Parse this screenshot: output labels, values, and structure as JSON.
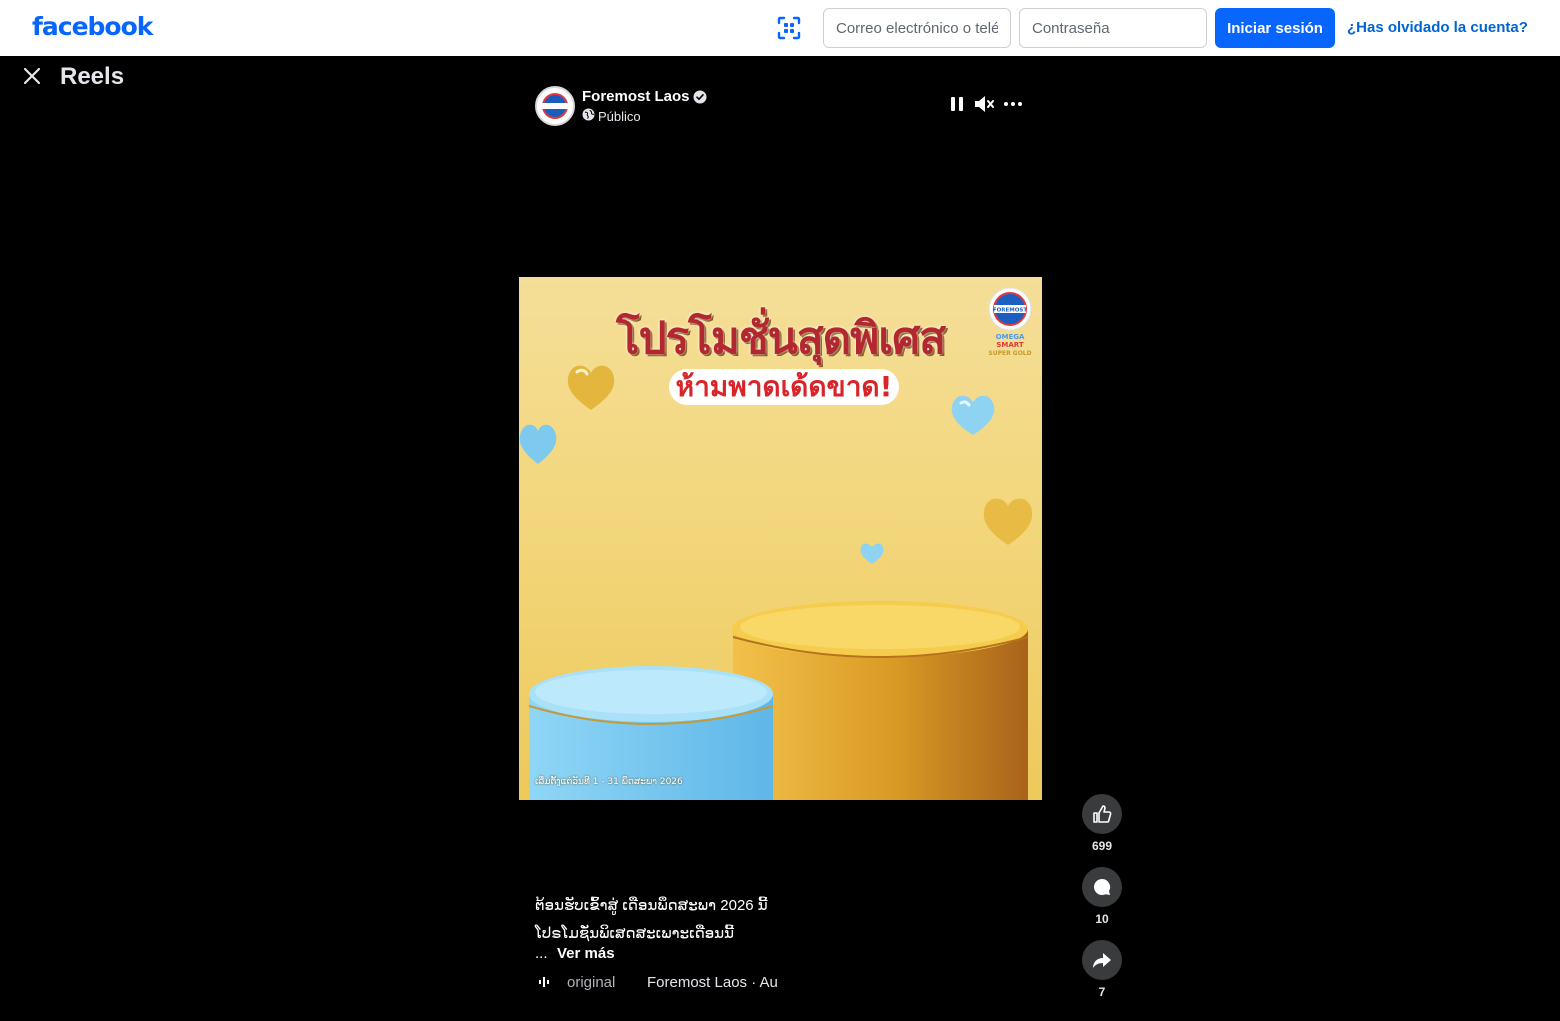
{
  "header": {
    "logo": "facebook",
    "email_placeholder": "Correo electrónico o teléfono",
    "password_placeholder": "Contraseña",
    "login_label": "Iniciar sesión",
    "forgot_label": "¿Has olvidado la cuenta?"
  },
  "reels": {
    "title": "Reels"
  },
  "post": {
    "page_name": "Foremost Laos",
    "privacy": "Público",
    "video": {
      "headline": "โปรโมชั่นสุดพิเศส",
      "subheadline": "ห้ามพาดเด้ดขาด!",
      "brand_badge": "FOREMOST OMEGA SMART SUPER GOLD",
      "date_line": "ເລີ່ມຕັ້ງແຕ່ວັນທີ 1 - 31 ພຶດສະພາ 2026"
    },
    "caption_line1": "ຕ້ອນຮັບເຂົ້າສູ່ ເດືອນພຶດສະພາ 2026 ນີ້ ",
    "caption_line2": "ໂປຣໂມຊັ່ນພິເສດສະເພາະເດືອນນີ້",
    "ellipsis": "... ",
    "see_more": "Ver más",
    "audio_label": "original",
    "audio_owner": "Foremost Laos · Au"
  },
  "actions": {
    "likes": "699",
    "comments": "10",
    "shares": "7"
  },
  "colors": {
    "brand_blue": "#0866ff",
    "link_blue": "#0064d1",
    "background": "#000000",
    "action_bg": "#3a3b3c"
  }
}
